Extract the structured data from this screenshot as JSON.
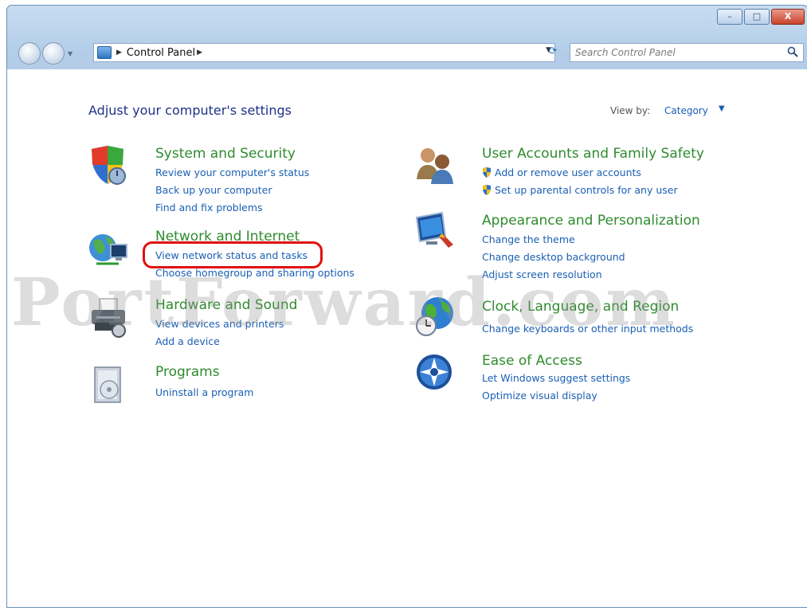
{
  "window": {
    "buttons": {
      "minimize": "–",
      "maximize": "□",
      "close": "X"
    }
  },
  "toolbar": {
    "breadcrumb": "Control Panel",
    "search_placeholder": "Search Control Panel"
  },
  "main": {
    "heading": "Adjust your computer's settings",
    "view_by_label": "View by:",
    "view_by_value": "Category"
  },
  "categories": [
    {
      "title": "System and Security",
      "icon": "shield-icon",
      "links": [
        "Review your computer's status",
        "Back up your computer",
        "Find and fix problems"
      ]
    },
    {
      "title": "Network and Internet",
      "icon": "network-globe-icon",
      "links": [
        "View network status and tasks",
        "Choose homegroup and sharing options"
      ]
    },
    {
      "title": "Hardware and Sound",
      "icon": "printer-icon",
      "links": [
        "View devices and printers",
        "Add a device"
      ]
    },
    {
      "title": "Programs",
      "icon": "programs-icon",
      "links": [
        "Uninstall a program"
      ]
    },
    {
      "title": "User Accounts and Family Safety",
      "icon": "users-icon",
      "links": [
        "Add or remove user accounts",
        "Set up parental controls for any user"
      ]
    },
    {
      "title": "Appearance and Personalization",
      "icon": "monitor-paint-icon",
      "links": [
        "Change the theme",
        "Change desktop background",
        "Adjust screen resolution"
      ]
    },
    {
      "title": "Clock, Language, and Region",
      "icon": "globe-clock-icon",
      "links": [
        "Change keyboards or other input methods"
      ]
    },
    {
      "title": "Ease of Access",
      "icon": "ease-of-access-icon",
      "links": [
        "Let Windows suggest settings",
        "Optimize visual display"
      ]
    }
  ],
  "watermark": "PortForward.com",
  "colors": {
    "category_title": "#2e8b2e",
    "link": "#1a5fb4",
    "heading": "#1e3287",
    "highlight": "#e01010"
  }
}
